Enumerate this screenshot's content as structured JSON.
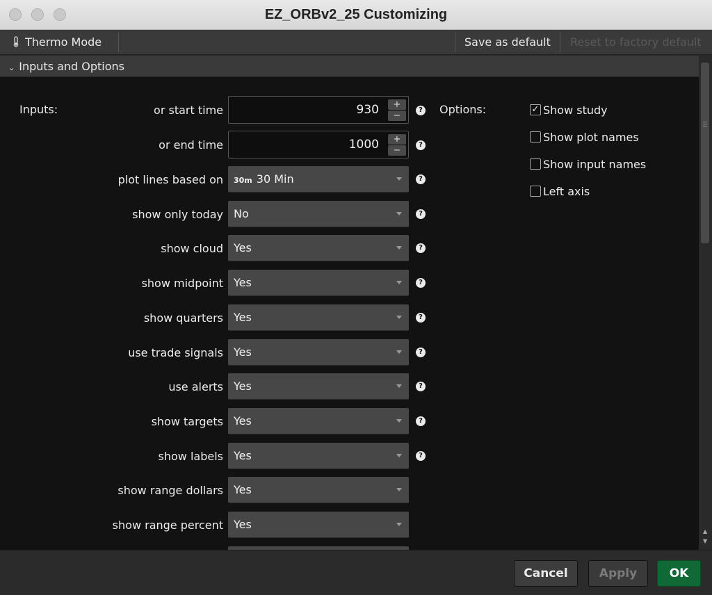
{
  "window": {
    "title": "EZ_ORBv2_25 Customizing"
  },
  "toolbar": {
    "thermo_label": "Thermo Mode",
    "save_default": "Save as default",
    "reset_default": "Reset to factory default"
  },
  "section": {
    "label": "Inputs and Options"
  },
  "inputs": {
    "heading": "Inputs:",
    "start_label": "or start time",
    "start_value": "930",
    "end_label": "or end time",
    "end_value": "1000",
    "selects": [
      {
        "label": "plot lines based on",
        "badge": "30m",
        "value": "30 Min",
        "help": true
      },
      {
        "label": "show only today",
        "value": "No",
        "help": true
      },
      {
        "label": "show cloud",
        "value": "Yes",
        "help": true
      },
      {
        "label": "show midpoint",
        "value": "Yes",
        "help": true
      },
      {
        "label": "show quarters",
        "value": "Yes",
        "help": true
      },
      {
        "label": "use trade signals",
        "value": "Yes",
        "help": true
      },
      {
        "label": "use alerts",
        "value": "Yes",
        "help": true
      },
      {
        "label": "show targets",
        "value": "Yes",
        "help": true
      },
      {
        "label": "show labels",
        "value": "Yes",
        "help": true
      },
      {
        "label": "show range dollars",
        "value": "Yes",
        "help": false
      },
      {
        "label": "show range percent",
        "value": "Yes",
        "help": false
      }
    ]
  },
  "options": {
    "heading": "Options:",
    "items": [
      {
        "label": "Show study",
        "checked": true
      },
      {
        "label": "Show plot names",
        "checked": false
      },
      {
        "label": "Show input names",
        "checked": false
      },
      {
        "label": "Left axis",
        "checked": false
      }
    ]
  },
  "footer": {
    "cancel": "Cancel",
    "apply": "Apply",
    "ok": "OK"
  },
  "colors": {
    "ok": "#0f6a35",
    "content_bg": "#121212",
    "select_bg": "#474747"
  }
}
